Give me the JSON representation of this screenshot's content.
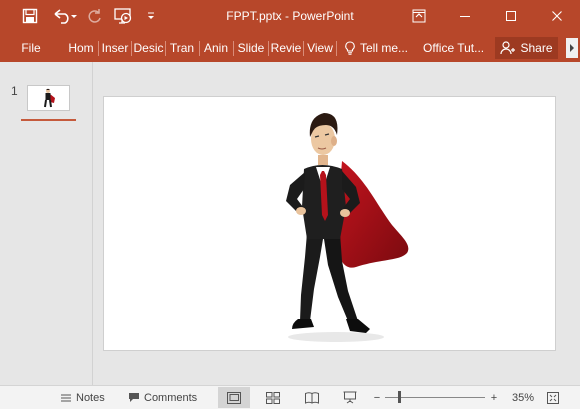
{
  "window": {
    "title": "FPPT.pptx - PowerPoint",
    "qat": {
      "save_icon": "save-icon",
      "undo_icon": "undo-icon",
      "redo_icon": "redo-icon",
      "present_icon": "present-from-beginning-icon",
      "customize_icon": "customize-qat-icon"
    },
    "controls": {
      "restore_ribbon_icon": "ribbon-display-options-icon",
      "minimize_icon": "minimize-icon",
      "maximize_icon": "maximize-icon",
      "close_icon": "close-icon"
    }
  },
  "ribbon": {
    "tabs": [
      "File",
      "Hom",
      "Inser",
      "Desic",
      "Tran",
      "Anin",
      "Slide",
      "Revie",
      "View"
    ],
    "tell_me": "Tell me...",
    "office_tut": "Office Tut...",
    "share": "Share"
  },
  "thumbnails": [
    {
      "number": "1"
    }
  ],
  "statusbar": {
    "notes": "Notes",
    "comments": "Comments",
    "zoom_minus": "−",
    "zoom_plus": "+",
    "zoom_level": "35%"
  },
  "colors": {
    "accent": "#b7472a",
    "share_bg": "#9d3a21",
    "cape_red": "#b5121b"
  }
}
